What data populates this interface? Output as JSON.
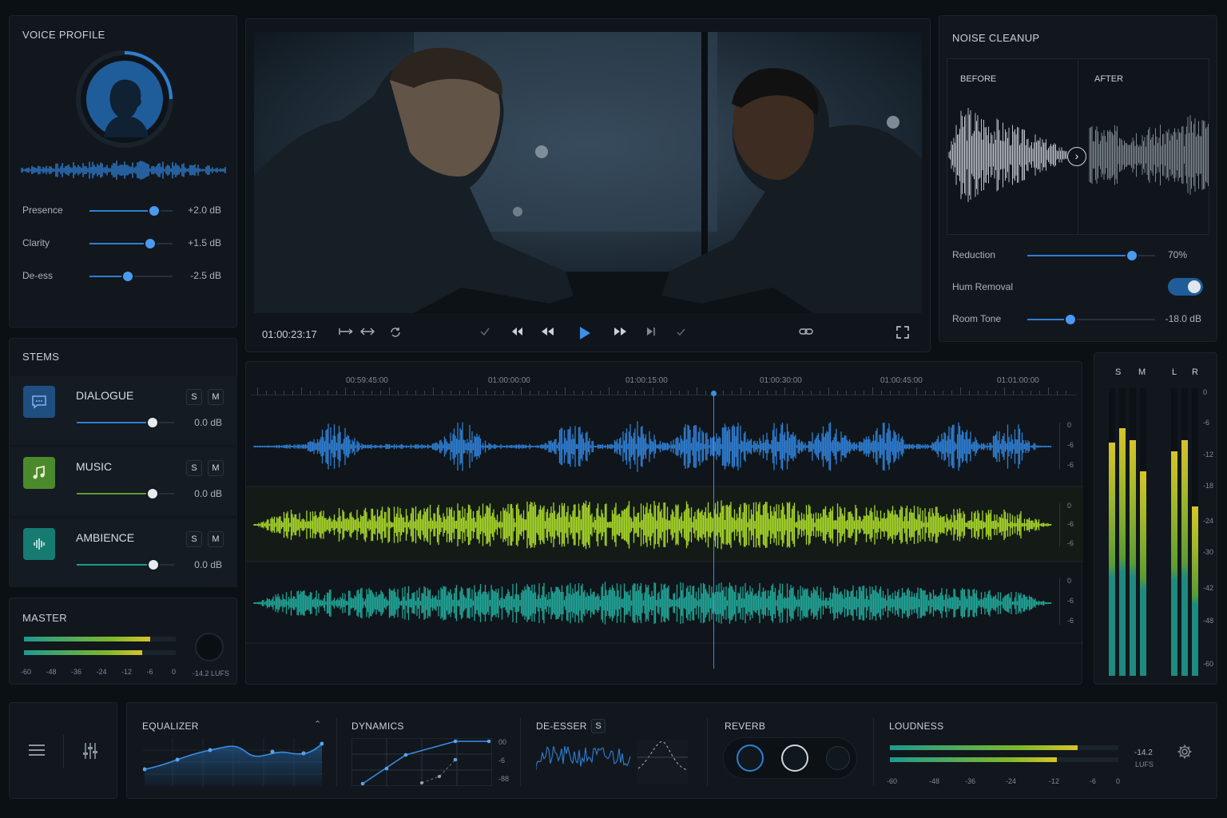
{
  "voice_profile": {
    "title": "VOICE PROFILE",
    "sliders": [
      {
        "label": "Presence",
        "value": "+2.0 dB",
        "level": 0.78
      },
      {
        "label": "Clarity",
        "value": "+1.5 dB",
        "level": 0.73
      },
      {
        "label": "De-ess",
        "value": "-2.5 dB",
        "level": 0.46
      }
    ]
  },
  "stems": {
    "title": "STEMS",
    "items": [
      {
        "name": "DIALOGUE",
        "value": "0.0 dB",
        "level": 0.78,
        "color": "#2f7fd4",
        "solo": "S",
        "mute": "M"
      },
      {
        "name": "MUSIC",
        "value": "0.0 dB",
        "level": 0.78,
        "color": "#5f9a2e",
        "solo": "S",
        "mute": "M"
      },
      {
        "name": "AMBIENCE",
        "value": "0.0 dB",
        "level": 0.79,
        "color": "#1f9a8e",
        "solo": "S",
        "mute": "M"
      }
    ]
  },
  "master": {
    "title": "MASTER",
    "scale": [
      "-60",
      "-48",
      "-36",
      "-24",
      "-12",
      "-6",
      "0"
    ],
    "lufs": "-14.2 LUFS",
    "meters": [
      0.83,
      0.78
    ]
  },
  "player": {
    "timecode": "01:00:23:17"
  },
  "noise_cleanup": {
    "title": "NOISE CLEANUP",
    "before": "BEFORE",
    "after": "AFTER",
    "reduction": {
      "label": "Reduction",
      "value": "70%",
      "level": 0.82
    },
    "hum": {
      "label": "Hum Removal",
      "on": true
    },
    "room_tone": {
      "label": "Room Tone",
      "value": "-18.0 dB",
      "level": 0.34
    }
  },
  "timeline": {
    "ruler": [
      "00:59:45:00",
      "01:00:00:00",
      "01:00:15:00",
      "01:00:30:00",
      "01:00:45:00",
      "01:01:00:00"
    ],
    "track_scale": [
      "0",
      "-6",
      "-6"
    ],
    "playhead": 0.56
  },
  "meters_right": {
    "headers": [
      "S",
      "M",
      "L",
      "R"
    ],
    "scale": [
      "0",
      "-6",
      "-12",
      "-18",
      "-24",
      "-30",
      "-42",
      "-48",
      "-60"
    ],
    "levels": [
      0.81,
      0.86,
      0.82,
      0.71,
      0.78,
      0.82,
      0.59
    ]
  },
  "bottom": {
    "equalizer": "EQUALIZER",
    "dynamics": "DYNAMICS",
    "dyn_scale": [
      "00",
      "-6",
      "-88"
    ],
    "deesser": "DE-ESSER",
    "deesser_s": "S",
    "reverb": "REVERB",
    "loudness": "LOUDNESS",
    "loud_scale": [
      "-60",
      "-48",
      "-36",
      "-24",
      "-12",
      "-6",
      "0"
    ],
    "loud_value": "-14.2",
    "loud_unit": "LUFS",
    "loud_meters": [
      0.82,
      0.73
    ]
  },
  "colors": {
    "accent": "#2f7fd4",
    "music": "#a7d62a",
    "ambience": "#21a597"
  }
}
